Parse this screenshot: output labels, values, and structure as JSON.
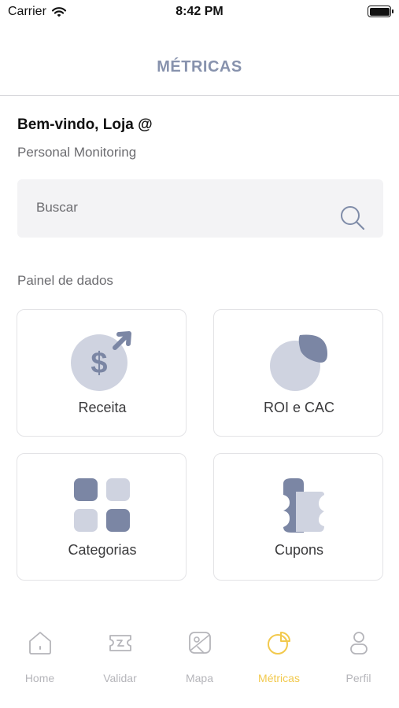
{
  "status_bar": {
    "carrier": "Carrier",
    "time": "8:42 PM"
  },
  "header": {
    "title": "MÉTRICAS"
  },
  "welcome": {
    "title": "Bem-vindo, Loja @",
    "subtitle": "Personal Monitoring"
  },
  "search": {
    "placeholder": "Buscar",
    "icon": "search-icon"
  },
  "dashboard": {
    "label": "Painel de dados",
    "cards": [
      {
        "label": "Receita",
        "icon": "dollar-growth-icon"
      },
      {
        "label": "ROI e CAC",
        "icon": "pie-chart-icon"
      },
      {
        "label": "Categorias",
        "icon": "grid-icon"
      },
      {
        "label": "Cupons",
        "icon": "coupon-icon"
      }
    ]
  },
  "tab_bar": {
    "active": "Métricas",
    "accent_color": "#f2c94c",
    "items": [
      {
        "label": "Home",
        "icon": "home-icon"
      },
      {
        "label": "Validar",
        "icon": "ticket-icon"
      },
      {
        "label": "Mapa",
        "icon": "map-icon"
      },
      {
        "label": "Métricas",
        "icon": "chart-icon"
      },
      {
        "label": "Perfil",
        "icon": "profile-icon"
      }
    ]
  },
  "colors": {
    "title": "#8792ad",
    "icon_dark": "#7b86a4",
    "icon_light": "#cfd3e0"
  }
}
